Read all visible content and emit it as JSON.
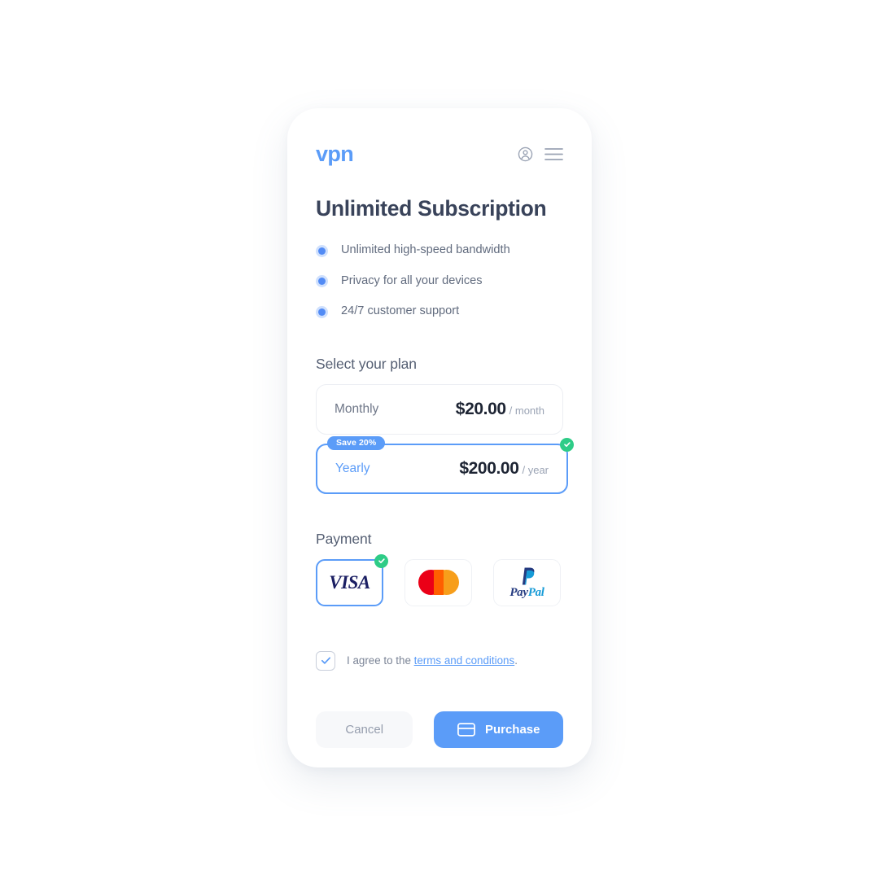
{
  "brand": {
    "logo_text": "vpn",
    "accent_color": "#5b9cf8",
    "title_color": "#39435a",
    "success_color": "#2ecc87"
  },
  "header": {
    "account_icon": "account-circle-icon",
    "menu_icon": "hamburger-menu-icon"
  },
  "page": {
    "title": "Unlimited Subscription"
  },
  "features": [
    {
      "label": "Unlimited high-speed bandwidth"
    },
    {
      "label": "Privacy for all your devices"
    },
    {
      "label": "24/7 customer support"
    }
  ],
  "plans": {
    "heading": "Select your plan",
    "items": [
      {
        "name": "Monthly",
        "price": "$20.00",
        "period": "/ month",
        "selected": false,
        "badge": null
      },
      {
        "name": "Yearly",
        "price": "$200.00",
        "period": "/ year",
        "selected": true,
        "badge": "Save 20%"
      }
    ]
  },
  "payment": {
    "heading": "Payment",
    "methods": [
      {
        "name": "VISA",
        "icon": "visa-logo",
        "selected": true
      },
      {
        "name": "Mastercard",
        "icon": "mastercard-logo",
        "selected": false
      },
      {
        "name": "PayPal",
        "icon": "paypal-logo",
        "selected": false
      }
    ],
    "paypal_text": {
      "first": "Pay",
      "second": "Pal"
    }
  },
  "terms": {
    "checked": true,
    "text_before": "I agree to the ",
    "link_text": "terms and conditions",
    "text_after": "."
  },
  "actions": {
    "cancel_label": "Cancel",
    "purchase_label": "Purchase",
    "purchase_icon": "credit-card-icon"
  }
}
